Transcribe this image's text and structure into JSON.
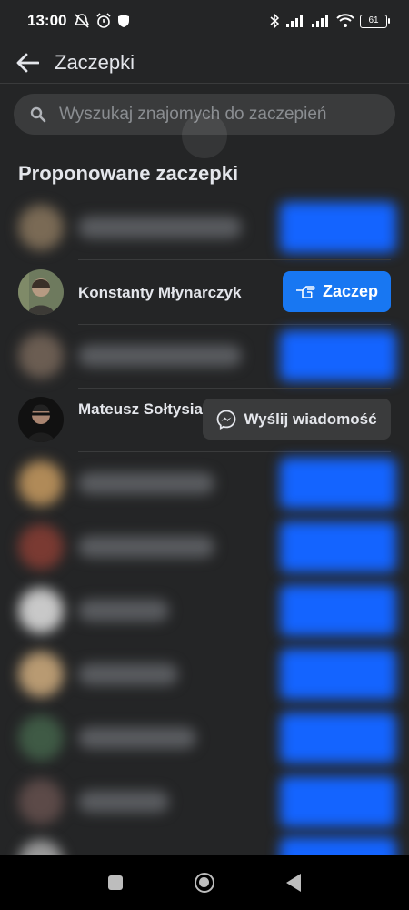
{
  "status_bar": {
    "time": "13:00",
    "battery": "61"
  },
  "header": {
    "title": "Zaczepki"
  },
  "search": {
    "placeholder": "Wyszukaj znajomych do zaczepień"
  },
  "section": {
    "title": "Proponowane zaczepki"
  },
  "visible_rows": [
    {
      "name": "Konstanty Młynarczyk",
      "action": "Zaczep"
    },
    {
      "name": "Mateusz Sołtysiak",
      "action": "Wyślij wiadomość"
    }
  ],
  "colors": {
    "background": "#242526",
    "primary_button": "#1877f2",
    "secondary_button": "#3a3b3c",
    "text": "#e4e6eb"
  },
  "icons": [
    "back-arrow-icon",
    "search-icon",
    "poke-hand-icon",
    "messenger-icon",
    "bluetooth-icon",
    "wifi-icon",
    "signal-icon",
    "alarm-icon",
    "mute-icon",
    "shield-icon"
  ]
}
